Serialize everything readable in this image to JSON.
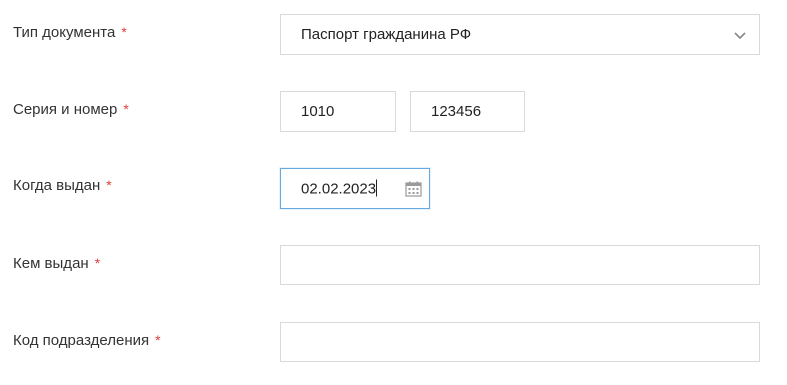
{
  "form": {
    "doc_type": {
      "label": "Тип документа",
      "required": "*",
      "value": "Паспорт гражданина РФ"
    },
    "series_number": {
      "label": "Серия и номер",
      "required": "*",
      "series_value": "1010",
      "number_value": "123456"
    },
    "issue_date": {
      "label": "Когда выдан",
      "required": "*",
      "value": "02.02.2023"
    },
    "issued_by": {
      "label": "Кем выдан",
      "required": "*",
      "value": ""
    },
    "division_code": {
      "label": "Код подразделения",
      "required": "*",
      "value": ""
    }
  },
  "colors": {
    "required_mark": "#e03c3c",
    "focus_border": "#66a8e0",
    "field_border": "#d9d9d9"
  },
  "icons": {
    "select": "chevron-down-icon",
    "date": "calendar-icon"
  }
}
